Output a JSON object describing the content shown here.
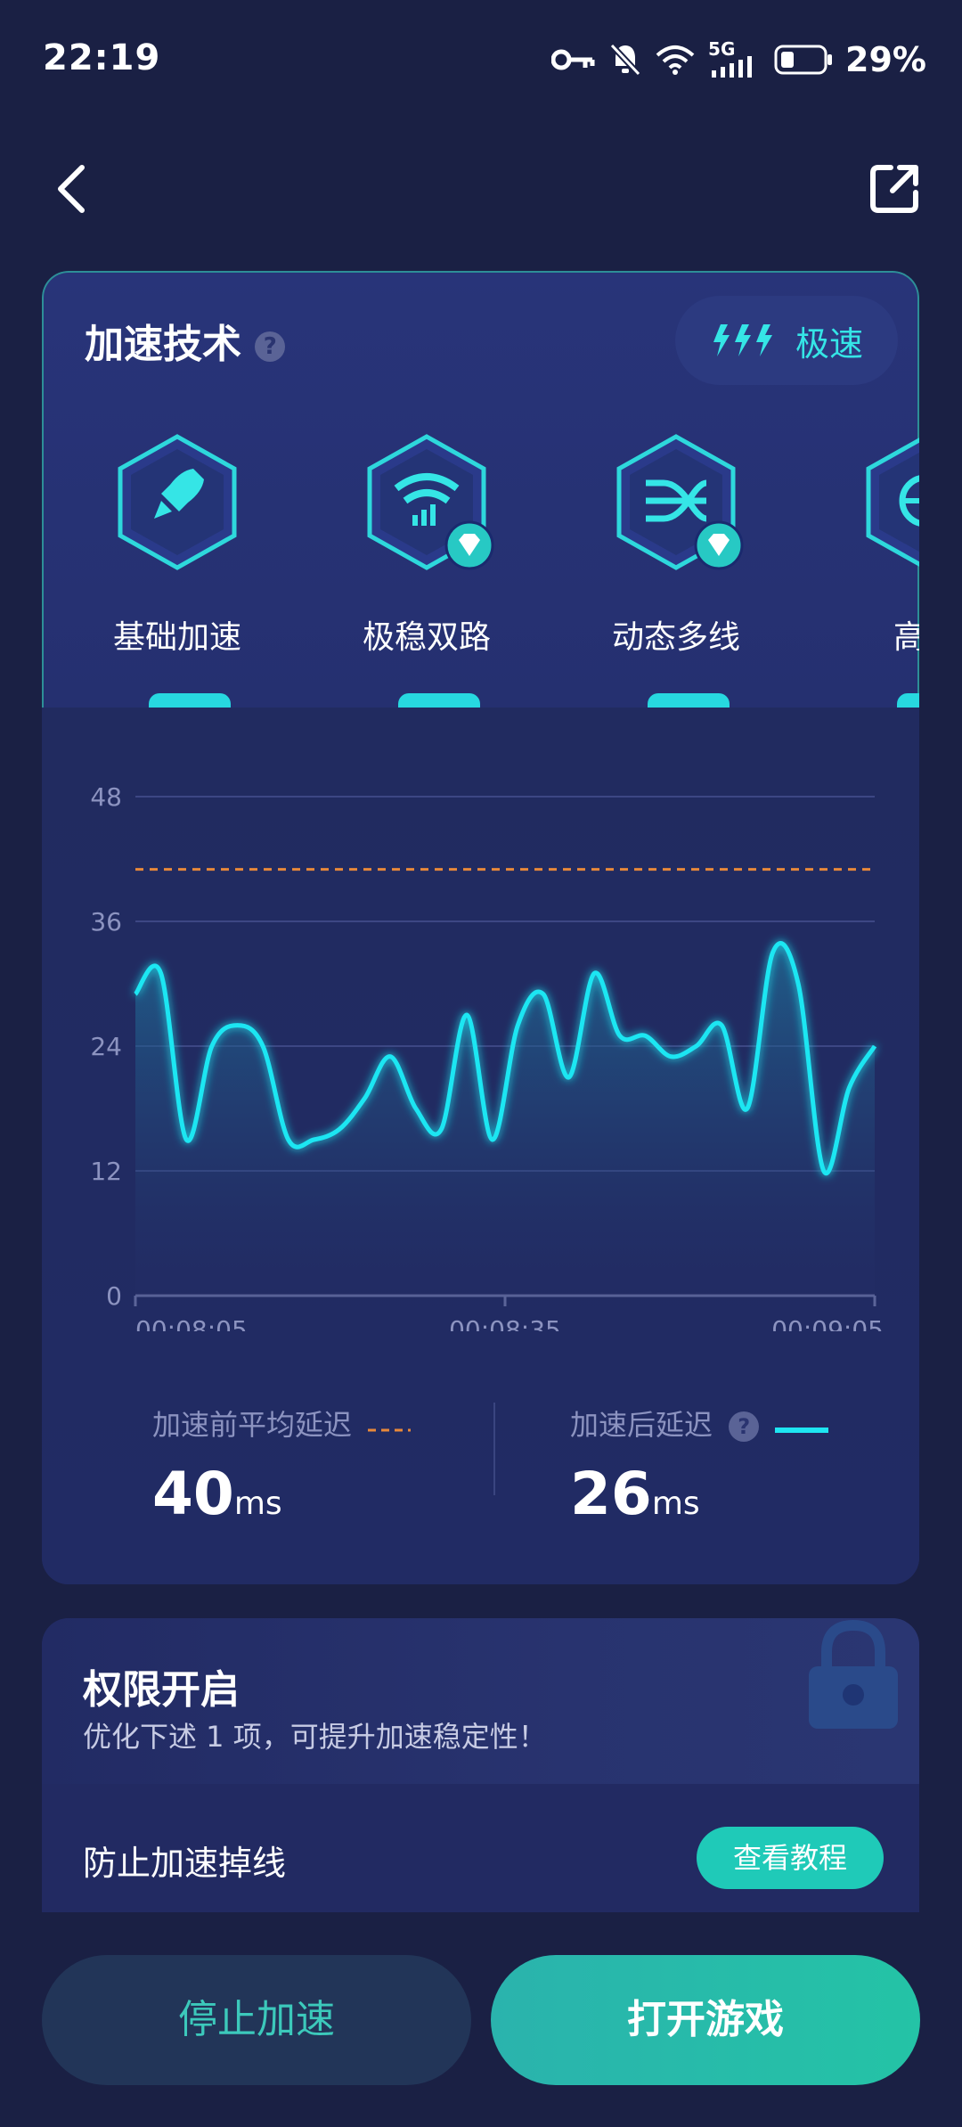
{
  "status_bar": {
    "time": "22:19",
    "network": "5G",
    "battery": "29%"
  },
  "nav": {
    "back_icon": "chevron-left-icon",
    "share_icon": "share-icon"
  },
  "tech_card": {
    "title": "加速技术",
    "help_glyph": "?",
    "mode_label": "极速",
    "items": [
      {
        "label": "基础加速",
        "icon": "rocket-icon",
        "premium": false
      },
      {
        "label": "极稳双路",
        "icon": "wifi-signal-icon",
        "premium": true
      },
      {
        "label": "动态多线",
        "icon": "multi-line-icon",
        "premium": true
      },
      {
        "label": "高速",
        "icon": "globe-icon",
        "premium": false
      }
    ]
  },
  "chart_data": {
    "type": "line",
    "ylim": [
      0,
      48
    ],
    "yticks": [
      "0",
      "12",
      "24",
      "36",
      "48"
    ],
    "xticks": [
      "00:08:05",
      "00:08:35",
      "00:09:05"
    ],
    "baseline": 41,
    "accent_color": "#1ee6f2",
    "baseline_color": "#e8893a",
    "series": [
      {
        "values": [
          29,
          31,
          15,
          24,
          26,
          24,
          15,
          15,
          16,
          19,
          23,
          18,
          16,
          27,
          15,
          26,
          29,
          21,
          31,
          25,
          25,
          23,
          24,
          26,
          18,
          33,
          30,
          12,
          20,
          24
        ]
      }
    ]
  },
  "latency": {
    "before_label": "加速前平均延迟",
    "before_value": "40",
    "after_label": "加速后延迟",
    "after_value": "26",
    "unit": "ms"
  },
  "permission": {
    "title": "权限开启",
    "subtitle": "优化下述 1 项，可提升加速稳定性！",
    "item_label": "防止加速掉线",
    "tutorial_label": "查看教程"
  },
  "actions": {
    "stop_label": "停止加速",
    "open_label": "打开游戏"
  }
}
